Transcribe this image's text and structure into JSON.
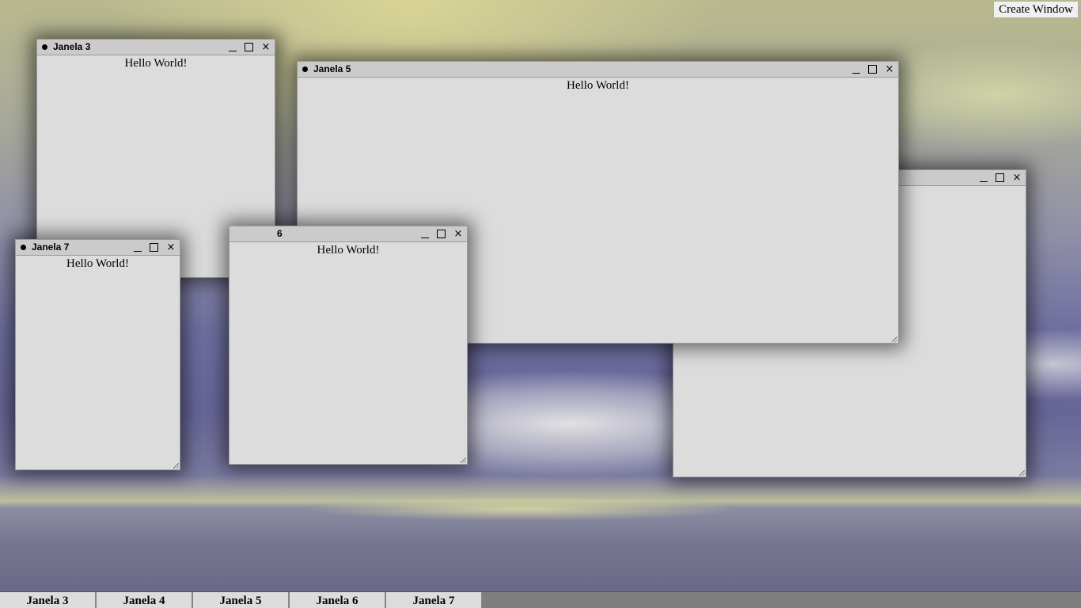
{
  "toolbar": {
    "create_window_label": "Create Window"
  },
  "windows": [
    {
      "id": "janela-3",
      "title": "Janela 3",
      "content": "Hello World!"
    },
    {
      "id": "janela-4",
      "title": "",
      "content": ""
    },
    {
      "id": "janela-5",
      "title": "Janela 5",
      "content": "Hello World!"
    },
    {
      "id": "janela-6",
      "title": "6",
      "content": "Hello World!"
    },
    {
      "id": "janela-7",
      "title": "Janela 7",
      "content": "Hello World!"
    }
  ],
  "window_controls": {
    "close_glyph": "×"
  },
  "taskbar": {
    "items": [
      {
        "label": "Janela 3"
      },
      {
        "label": "Janela 4"
      },
      {
        "label": "Janela 5"
      },
      {
        "label": "Janela 6"
      },
      {
        "label": "Janela 7"
      }
    ]
  },
  "icons": [
    "minimize-icon",
    "maximize-icon",
    "close-icon",
    "resize-grip-icon",
    "window-dot-icon"
  ]
}
